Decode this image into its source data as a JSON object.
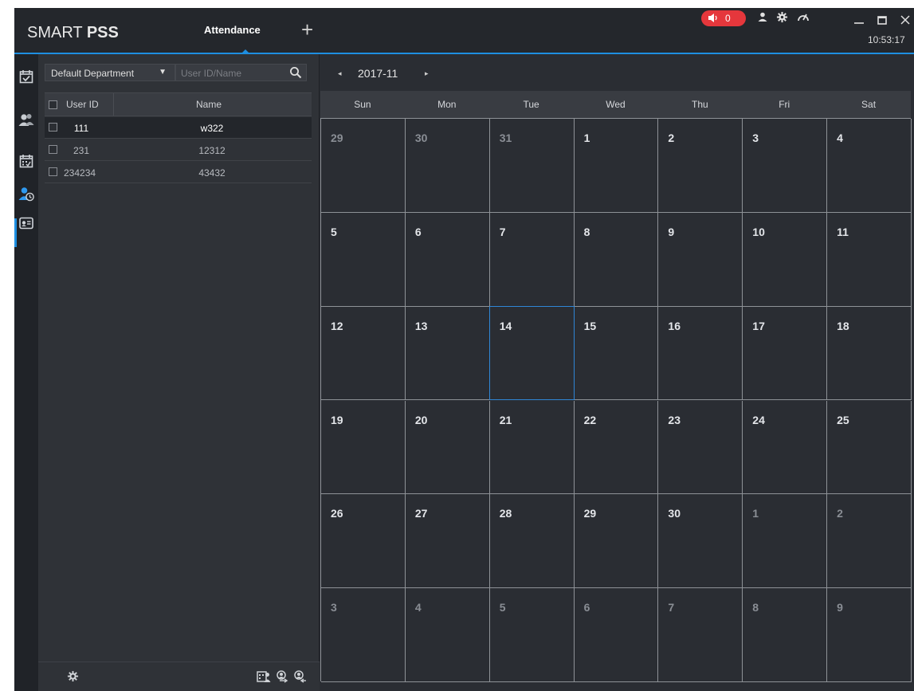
{
  "app": {
    "logo_light": "SMART ",
    "logo_bold": "PSS",
    "active_tab": "Attendance",
    "add_tab_glyph": "+",
    "alarm_count": "0",
    "clock": "10:53:17",
    "accent_color": "#1e8fe1",
    "alarm_color": "#e5373c"
  },
  "titlebar_icons": [
    "alarm-speaker-icon",
    "user-icon",
    "settings-icon",
    "performance-icon",
    "minimize-icon",
    "maximize-icon",
    "close-icon"
  ],
  "nav": [
    "attendance-check-icon",
    "user-group-icon",
    "schedule-icon",
    "user-attendance-icon",
    "report-card-icon"
  ],
  "user_panel": {
    "department": "Default Department",
    "search_placeholder": "User ID/Name",
    "col_user_id": "User ID",
    "col_name": "Name",
    "rows": [
      {
        "user_id": "111",
        "name": "w322",
        "selected": true
      },
      {
        "user_id": "231",
        "name": "12312",
        "selected": false
      },
      {
        "user_id": "234234",
        "name": "43432",
        "selected": false
      }
    ],
    "footer_icons": [
      "settings-icon",
      "attendance-record-icon",
      "user-sync-icon",
      "user-export-icon"
    ]
  },
  "calendar": {
    "month_label": "2017-11",
    "prev_glyph": "◂",
    "next_glyph": "▸",
    "weekdays": [
      "Sun",
      "Mon",
      "Tue",
      "Wed",
      "Thu",
      "Fri",
      "Sat"
    ],
    "weeks": [
      [
        {
          "d": "29",
          "cur": false
        },
        {
          "d": "30",
          "cur": false
        },
        {
          "d": "31",
          "cur": false
        },
        {
          "d": "1",
          "cur": true
        },
        {
          "d": "2",
          "cur": true
        },
        {
          "d": "3",
          "cur": true
        },
        {
          "d": "4",
          "cur": true
        }
      ],
      [
        {
          "d": "5",
          "cur": true
        },
        {
          "d": "6",
          "cur": true
        },
        {
          "d": "7",
          "cur": true
        },
        {
          "d": "8",
          "cur": true
        },
        {
          "d": "9",
          "cur": true
        },
        {
          "d": "10",
          "cur": true
        },
        {
          "d": "11",
          "cur": true
        }
      ],
      [
        {
          "d": "12",
          "cur": true
        },
        {
          "d": "13",
          "cur": true
        },
        {
          "d": "14",
          "cur": true,
          "today": true
        },
        {
          "d": "15",
          "cur": true
        },
        {
          "d": "16",
          "cur": true
        },
        {
          "d": "17",
          "cur": true
        },
        {
          "d": "18",
          "cur": true
        }
      ],
      [
        {
          "d": "19",
          "cur": true
        },
        {
          "d": "20",
          "cur": true
        },
        {
          "d": "21",
          "cur": true
        },
        {
          "d": "22",
          "cur": true
        },
        {
          "d": "23",
          "cur": true
        },
        {
          "d": "24",
          "cur": true
        },
        {
          "d": "25",
          "cur": true
        }
      ],
      [
        {
          "d": "26",
          "cur": true
        },
        {
          "d": "27",
          "cur": true
        },
        {
          "d": "28",
          "cur": true
        },
        {
          "d": "29",
          "cur": true
        },
        {
          "d": "30",
          "cur": true
        },
        {
          "d": "1",
          "cur": false
        },
        {
          "d": "2",
          "cur": false
        }
      ],
      [
        {
          "d": "3",
          "cur": false
        },
        {
          "d": "4",
          "cur": false
        },
        {
          "d": "5",
          "cur": false
        },
        {
          "d": "6",
          "cur": false
        },
        {
          "d": "7",
          "cur": false
        },
        {
          "d": "8",
          "cur": false
        },
        {
          "d": "9",
          "cur": false
        }
      ]
    ]
  }
}
